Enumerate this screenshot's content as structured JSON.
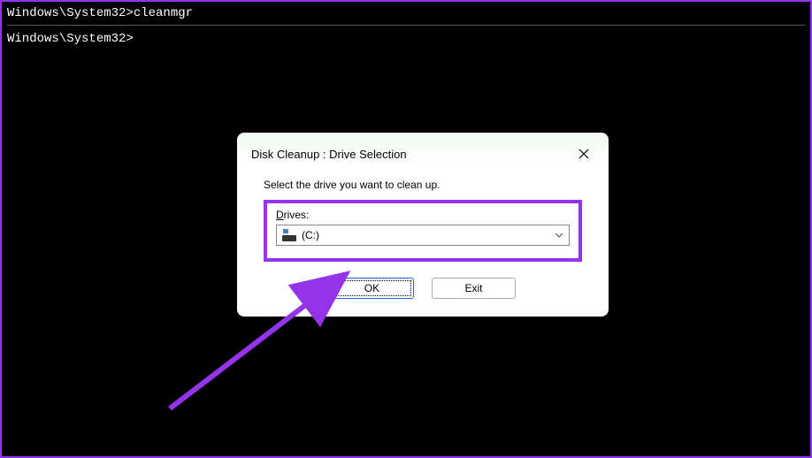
{
  "terminal": {
    "line1": "Windows\\System32>cleanmgr",
    "line2": "Windows\\System32>"
  },
  "dialog": {
    "title": "Disk Cleanup : Drive Selection",
    "instruction": "Select the drive you want to clean up.",
    "drives_label_underline": "D",
    "drives_label_rest": "rives:",
    "selected_drive": " (C:)",
    "ok_label": "OK",
    "exit_label": "Exit"
  }
}
